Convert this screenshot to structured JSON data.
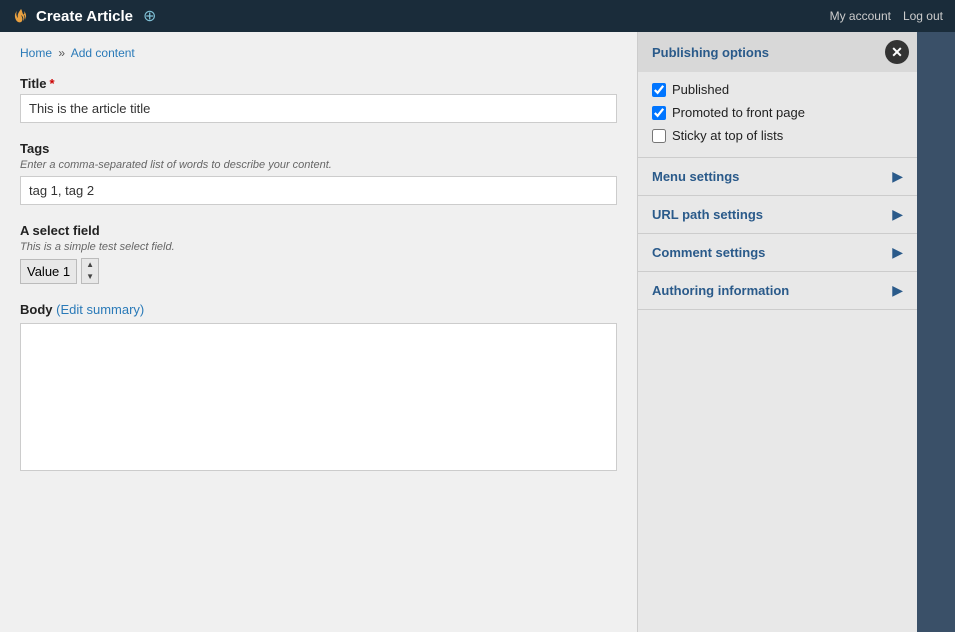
{
  "topbar": {
    "title": "Create Article",
    "add_icon": "⊕",
    "links": [
      "My account",
      "Log out"
    ]
  },
  "breadcrumb": {
    "home": "Home",
    "separator": "»",
    "current": "Add content"
  },
  "form": {
    "title_label": "Title",
    "title_required": "*",
    "title_value": "This is the article title",
    "tags_label": "Tags",
    "tags_description": "Enter a comma-separated list of words to describe your content.",
    "tags_value": "tag 1, tag 2",
    "select_label": "A select field",
    "select_description": "This is a simple test select field.",
    "select_value": "Value 1",
    "body_label": "Body",
    "body_edit_summary": "(Edit summary)",
    "body_value": ""
  },
  "sidebar": {
    "publishing_title": "Publishing options",
    "expand_icon": "▾",
    "published_label": "Published",
    "published_checked": true,
    "front_page_label": "Promoted to front page",
    "front_page_checked": true,
    "sticky_label": "Sticky at top of lists",
    "sticky_checked": false,
    "items": [
      {
        "label": "Menu settings",
        "arrow": "▶"
      },
      {
        "label": "URL path settings",
        "arrow": "▶"
      },
      {
        "label": "Comment settings",
        "arrow": "▶"
      },
      {
        "label": "Authoring information",
        "arrow": "▶"
      }
    ],
    "close_icon": "✕"
  }
}
